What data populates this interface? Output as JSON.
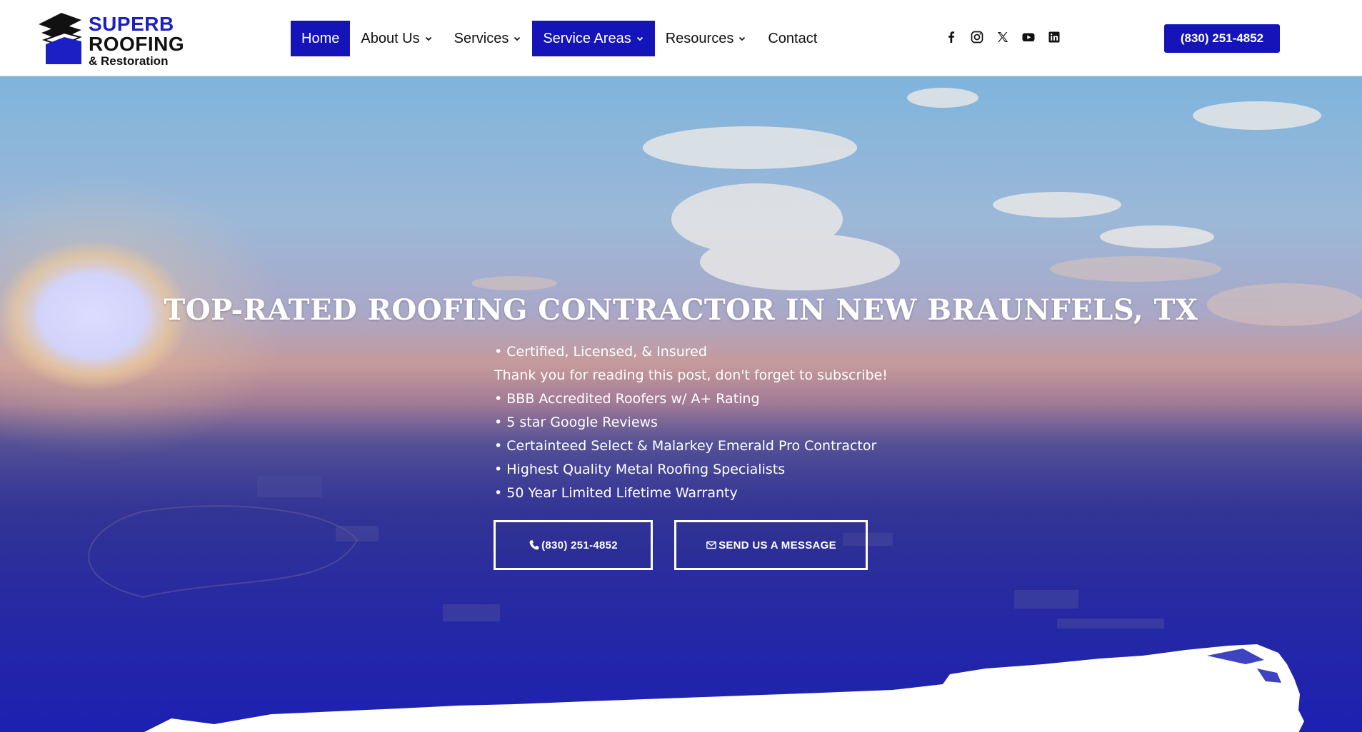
{
  "brand": {
    "line1": "SUPERB",
    "line2": "ROOFING",
    "line3": "& Restoration",
    "primary_color": "#1414b8"
  },
  "nav": {
    "items": [
      {
        "label": "Home",
        "active": true,
        "dropdown": false
      },
      {
        "label": "About Us",
        "active": false,
        "dropdown": true
      },
      {
        "label": "Services",
        "active": false,
        "dropdown": true
      },
      {
        "label": "Service Areas",
        "active": true,
        "dropdown": true
      },
      {
        "label": "Resources",
        "active": false,
        "dropdown": true
      },
      {
        "label": "Contact",
        "active": false,
        "dropdown": false
      }
    ]
  },
  "social": [
    "facebook-icon",
    "instagram-icon",
    "x-icon",
    "youtube-icon",
    "linkedin-icon"
  ],
  "header": {
    "phone_label": "(830) 251-4852"
  },
  "hero": {
    "title": "TOP-RATED ROOFING CONTRACTOR IN NEW BRAUNFELS, TX",
    "bullets": [
      "• Certified, Licensed, & Insured",
      "Thank you for reading this post, don't forget to subscribe!",
      "• BBB Accredited Roofers w/ A+ Rating",
      "• 5 star Google Reviews",
      "• Certainteed Select & Malarkey Emerald Pro Contractor",
      "• Highest Quality Metal Roofing Specialists",
      "• 50 Year Limited Lifetime Warranty"
    ],
    "call_button": "(830) 251-4852",
    "message_button": "SEND US A MESSAGE"
  }
}
